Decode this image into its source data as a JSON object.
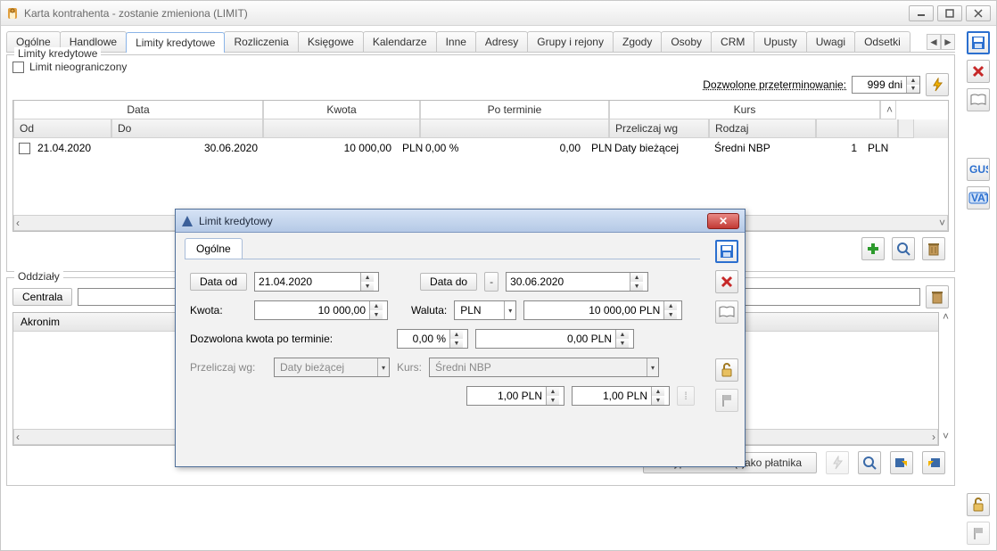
{
  "window": {
    "title": "Karta kontrahenta - zostanie zmieniona (LIMIT)"
  },
  "tabs": {
    "items": [
      "Ogólne",
      "Handlowe",
      "Limity kredytowe",
      "Rozliczenia",
      "Księgowe",
      "Kalendarze",
      "Inne",
      "Adresy",
      "Grupy i rejony",
      "Zgody",
      "Osoby",
      "CRM",
      "Upusty",
      "Uwagi",
      "Odsetki"
    ],
    "active_index": 2
  },
  "limits_group": {
    "title": "Limity kredytowe",
    "unlimited_label": "Limit nieograniczony",
    "przeterm_label": "Dozwolone przeterminowanie:",
    "przeterm_value": "999 dni"
  },
  "grid": {
    "head_groups": {
      "data": "Data",
      "kwota": "Kwota",
      "po_terminie": "Po terminie",
      "kurs": "Kurs"
    },
    "head": {
      "od": "Od",
      "do": "Do",
      "przeliczaj": "Przeliczaj wg",
      "rodzaj": "Rodzaj"
    },
    "row": {
      "od": "21.04.2020",
      "do": "30.06.2020",
      "kwota": "10 000,00",
      "kwota_cur": "PLN",
      "pct": "0,00 %",
      "pt_val": "0,00",
      "pt_cur": "PLN",
      "przeliczaj": "Daty bieżącej",
      "rodzaj": "Średni NBP",
      "kurs_v": "1",
      "kurs_cur": "PLN"
    }
  },
  "oddz": {
    "title": "Oddziały",
    "btn": "Centrala",
    "value": ""
  },
  "akronim": {
    "head": "Akronim"
  },
  "bottom": {
    "assign": "Przypisz centralę jako płatnika"
  },
  "dialog": {
    "title": "Limit kredytowy",
    "tab": "Ogólne",
    "labels": {
      "data_od": "Data od",
      "data_do": "Data do",
      "kwota": "Kwota:",
      "waluta": "Waluta:",
      "dozw": "Dozwolona kwota po terminie:",
      "przeliczaj": "Przeliczaj wg:",
      "kurs": "Kurs:"
    },
    "values": {
      "data_od": "21.04.2020",
      "data_do": "30.06.2020",
      "kwota": "10 000,00",
      "waluta": "PLN",
      "waluta_val": "10 000,00 PLN",
      "pct": "0,00 %",
      "pt": "0,00 PLN",
      "przeliczaj": "Daty bieżącej",
      "kurs": "Średni NBP",
      "rate1": "1,00 PLN",
      "rate2": "1,00 PLN"
    }
  }
}
